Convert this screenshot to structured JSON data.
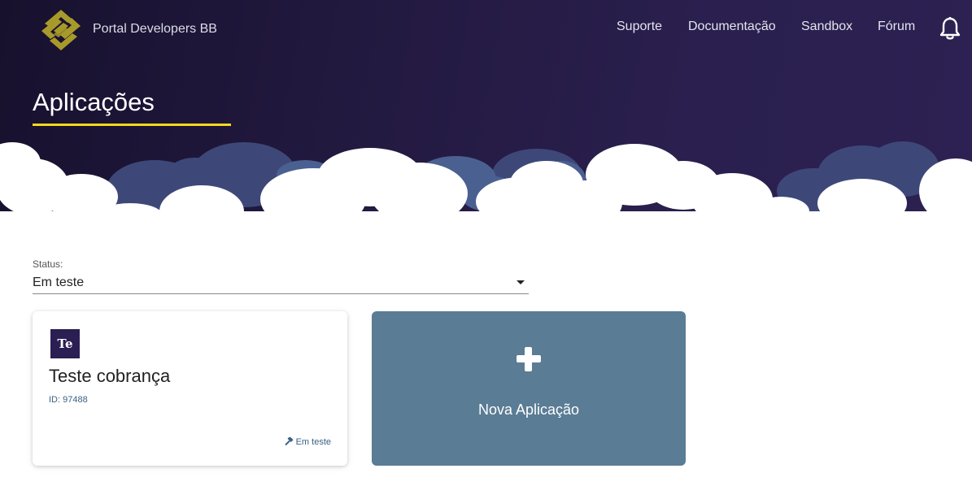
{
  "header": {
    "brand": "Portal Developers BB",
    "logo_icon": "banco-do-brasil-logo-icon",
    "nav": [
      "Suporte",
      "Documentação",
      "Sandbox",
      "Fórum"
    ],
    "notification_icon": "bell-icon"
  },
  "page": {
    "title": "Aplicações"
  },
  "filter": {
    "label": "Status:",
    "value": "Em teste"
  },
  "applications": [
    {
      "avatar": "Te",
      "name": "Teste cobrança",
      "id_text": "ID: 97488",
      "status": "Em teste",
      "status_icon": "hammer-icon"
    }
  ],
  "new_app": {
    "label": "Nova Aplicação",
    "icon": "plus-icon"
  },
  "colors": {
    "header_bg": "#22193f",
    "accent_yellow": "#f6d91c",
    "logo_gold": "#a89a2a",
    "new_card_bg": "#5a7c95",
    "avatar_bg": "#2a1e52"
  }
}
